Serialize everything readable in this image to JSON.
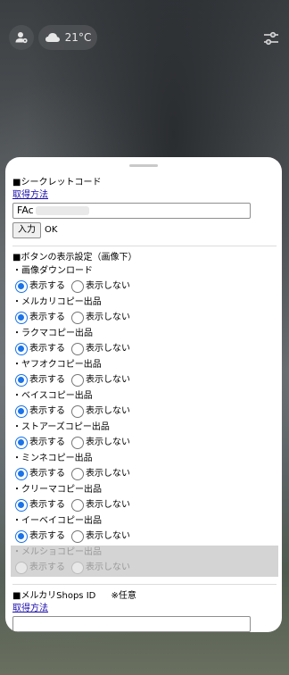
{
  "top_bar": {
    "temperature": "21°C"
  },
  "secret_code": {
    "heading": "■シークレットコード",
    "how_to_link": "取得方法",
    "input_value": "FAc",
    "submit_label": "入力",
    "status": "OK"
  },
  "display_settings": {
    "heading": "■ボタンの表示設定（画像下）",
    "show_label": "表示する",
    "hide_label": "表示しない",
    "items": [
      {
        "label": "・画像ダウンロード",
        "selected": "show",
        "disabled": false
      },
      {
        "label": "・メルカリコピー出品",
        "selected": "show",
        "disabled": false
      },
      {
        "label": "・ラクマコピー出品",
        "selected": "show",
        "disabled": false
      },
      {
        "label": "・ヤフオクコピー出品",
        "selected": "show",
        "disabled": false
      },
      {
        "label": "・ベイスコピー出品",
        "selected": "show",
        "disabled": false
      },
      {
        "label": "・ストアーズコピー出品",
        "selected": "show",
        "disabled": false
      },
      {
        "label": "・ミンネコピー出品",
        "selected": "show",
        "disabled": false
      },
      {
        "label": "・クリーマコピー出品",
        "selected": "show",
        "disabled": false
      },
      {
        "label": "・イーベイコピー出品",
        "selected": "show",
        "disabled": false
      },
      {
        "label": "・メルショコピー出品",
        "selected": "none",
        "disabled": true
      }
    ]
  },
  "shops_id": {
    "heading": "■メルカリShops ID",
    "optional_note": "※任意",
    "how_to_link": "取得方法",
    "input_value": ""
  },
  "colors": {
    "accent": "#1a73e8",
    "link": "#1a0dab"
  },
  "icons": [
    "person-icon",
    "cloud-icon",
    "sliders-icon"
  ]
}
